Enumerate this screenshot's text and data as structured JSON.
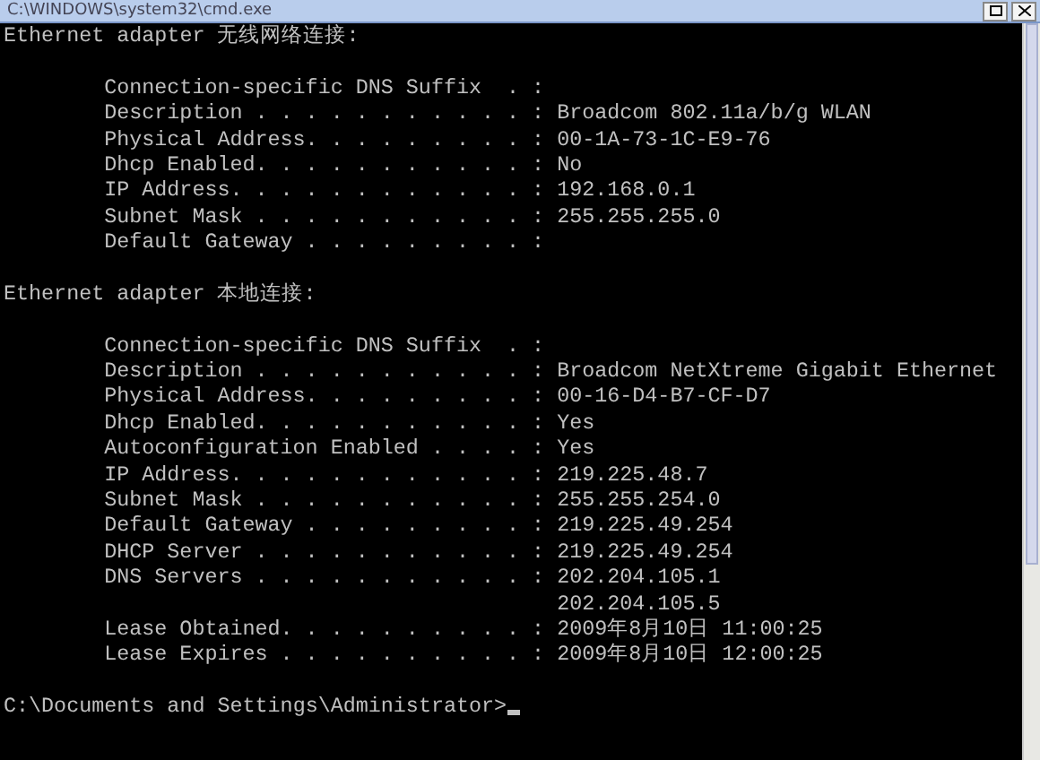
{
  "window": {
    "title": "C:\\WINDOWS\\system32\\cmd.exe"
  },
  "adapters": [
    {
      "heading": "Ethernet adapter 无线网络连接:",
      "entries": [
        {
          "label": "Connection-specific DNS Suffix  . :"
        },
        {
          "label": "Description . . . . . . . . . . . :",
          "value": "Broadcom 802.11a/b/g WLAN"
        },
        {
          "label": "Physical Address. . . . . . . . . :",
          "value": "00-1A-73-1C-E9-76"
        },
        {
          "label": "Dhcp Enabled. . . . . . . . . . . :",
          "value": "No"
        },
        {
          "label": "IP Address. . . . . . . . . . . . :",
          "value": "192.168.0.1"
        },
        {
          "label": "Subnet Mask . . . . . . . . . . . :",
          "value": "255.255.255.0"
        },
        {
          "label": "Default Gateway . . . . . . . . . :"
        }
      ]
    },
    {
      "heading": "Ethernet adapter 本地连接:",
      "entries": [
        {
          "label": "Connection-specific DNS Suffix  . :"
        },
        {
          "label": "Description . . . . . . . . . . . :",
          "value": "Broadcom NetXtreme Gigabit Ethernet"
        },
        {
          "label": "Physical Address. . . . . . . . . :",
          "value": "00-16-D4-B7-CF-D7"
        },
        {
          "label": "Dhcp Enabled. . . . . . . . . . . :",
          "value": "Yes"
        },
        {
          "label": "Autoconfiguration Enabled . . . . :",
          "value": "Yes"
        },
        {
          "label": "IP Address. . . . . . . . . . . . :",
          "value": "219.225.48.7"
        },
        {
          "label": "Subnet Mask . . . . . . . . . . . :",
          "value": "255.255.254.0"
        },
        {
          "label": "Default Gateway . . . . . . . . . :",
          "value": "219.225.49.254"
        },
        {
          "label": "DHCP Server . . . . . . . . . . . :",
          "value": "219.225.49.254"
        },
        {
          "label": "DNS Servers . . . . . . . . . . . :",
          "value": "202.204.105.1"
        },
        {
          "value": "202.204.105.5"
        },
        {
          "label": "Lease Obtained. . . . . . . . . . :",
          "value": "2009年8月10日 11:00:25"
        },
        {
          "label": "Lease Expires . . . . . . . . . . :",
          "value": "2009年8月10日 12:00:25"
        }
      ]
    }
  ],
  "prompt": "C:\\Documents and Settings\\Administrator>"
}
